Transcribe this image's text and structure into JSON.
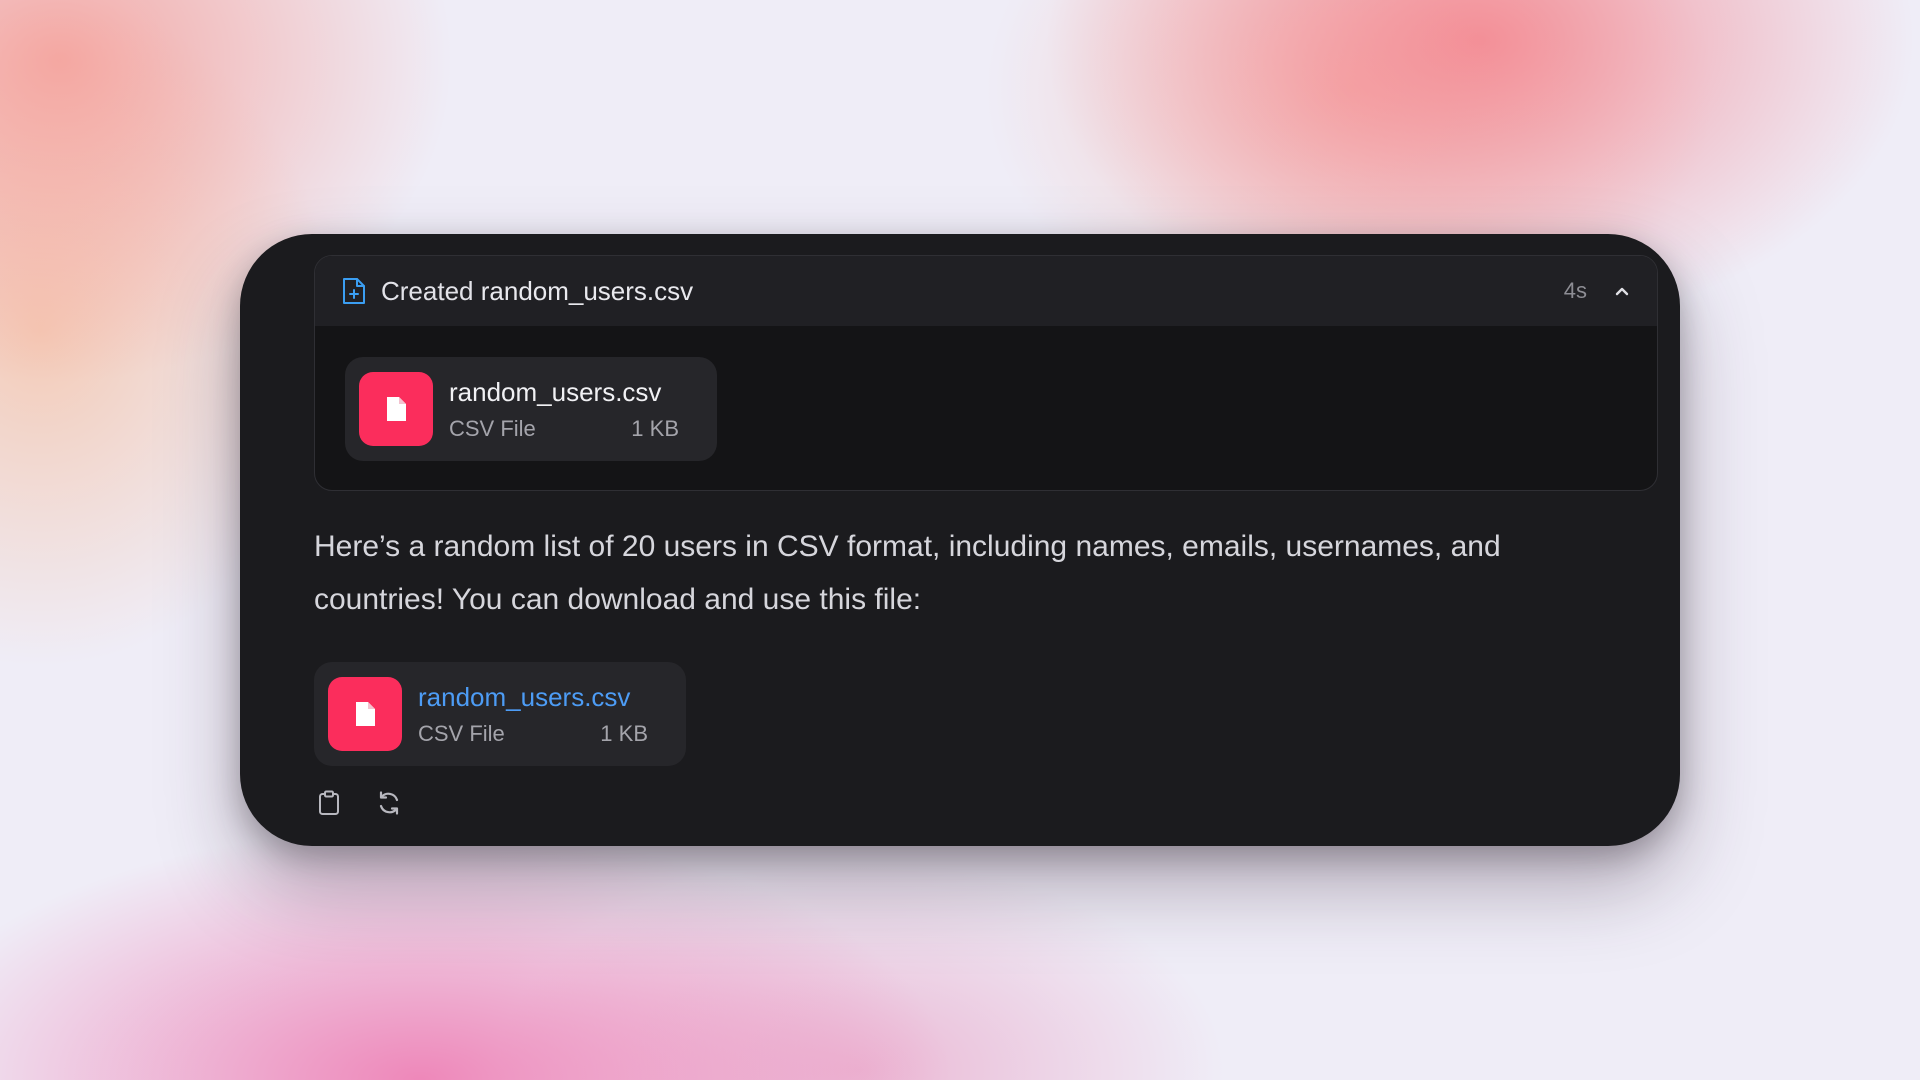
{
  "tool_call": {
    "verb": "Created",
    "filename": "random_users.csv",
    "duration": "4s",
    "attachment": {
      "name": "random_users.csv",
      "type": "CSV File",
      "size": "1 KB"
    }
  },
  "message": {
    "text": "Here’s a random list of 20 users in CSV format, including names, emails, usernames, and countries! You can download and use this file:"
  },
  "download": {
    "name": "random_users.csv",
    "type": "CSV File",
    "size": "1 KB"
  },
  "icons": {
    "header": "file-plus-icon",
    "collapse": "chevron-up-icon",
    "attachment": "file-icon",
    "copy": "clipboard-icon",
    "regenerate": "refresh-icon"
  },
  "colors": {
    "accent_file": "#fb2d5c",
    "link": "#4d9cf5",
    "header_icon": "#3b9ef2",
    "card_bg": "#1b1b1e"
  }
}
